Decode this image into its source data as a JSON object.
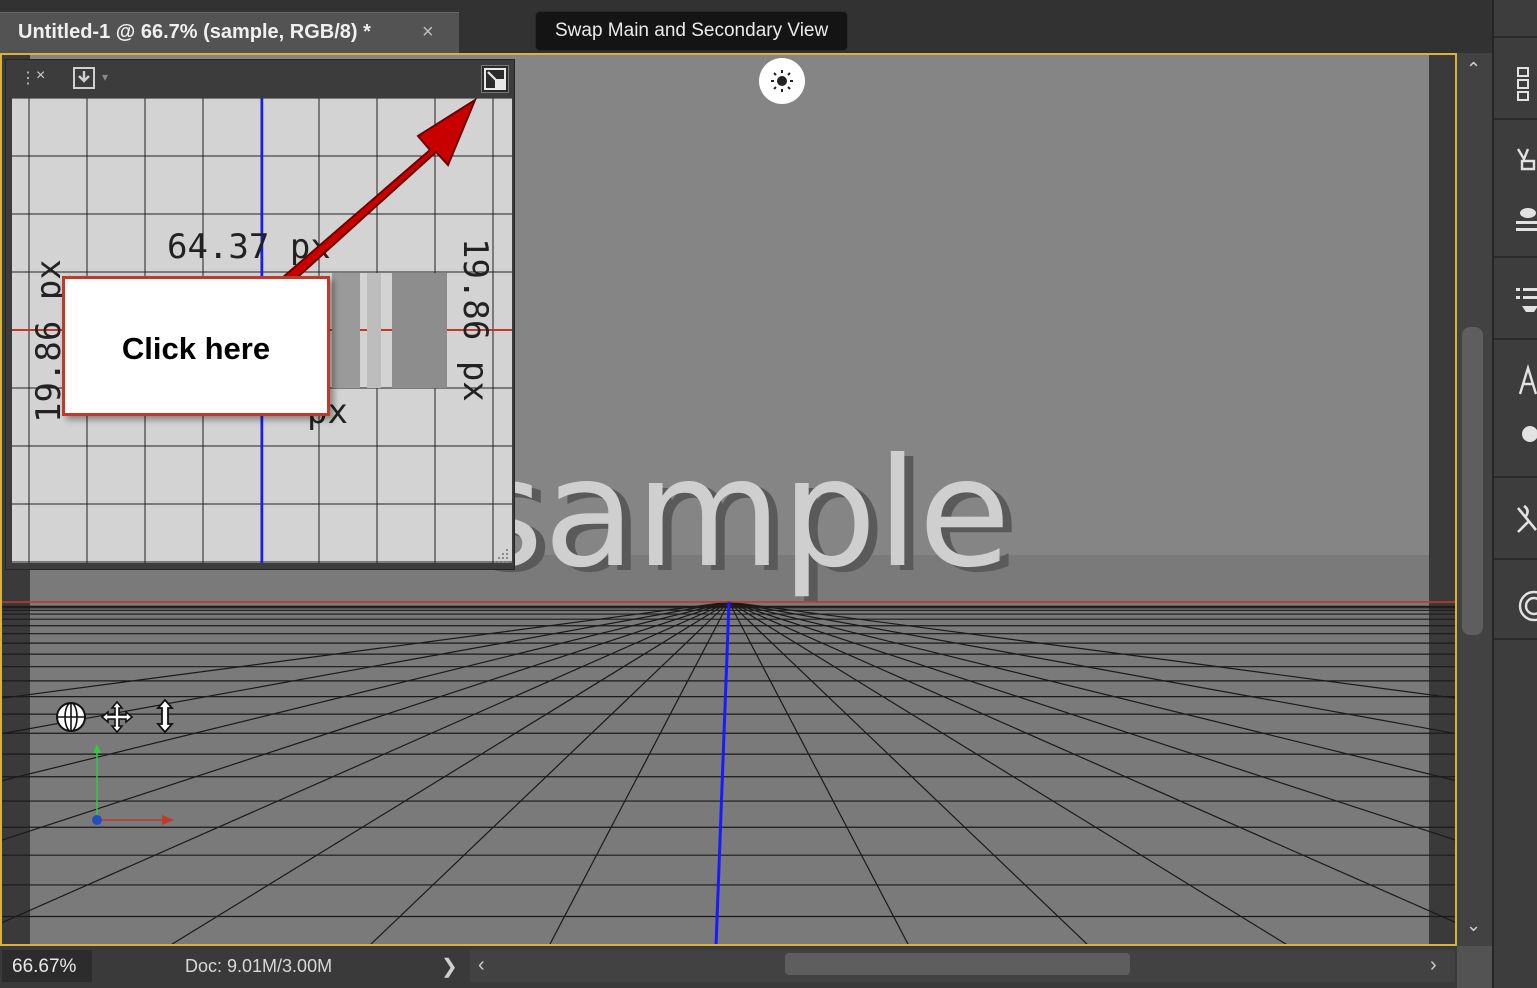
{
  "document_tab": {
    "title": "Untitled-1 @ 66.7% (sample, RGB/8) *",
    "close_glyph": "×"
  },
  "tooltip": {
    "text": "Swap Main and Secondary View"
  },
  "scene": {
    "text": "sample",
    "colors": {
      "background": "#7d7d7d",
      "grid_line": "#1a1a1a",
      "x_axis": "#c0392b",
      "y_axis": "#1a1aff",
      "frame": "#d6b33a"
    }
  },
  "secondary_view": {
    "close_glyph": "×",
    "measure_top": "64.37 px",
    "measure_left": "19.86 px",
    "measure_right": "19.86 px",
    "measure_bottom_partial": "px",
    "icons": [
      "grip-icon",
      "close-icon",
      "export-icon",
      "swap-view-icon"
    ]
  },
  "callout": {
    "text": "Click here",
    "border_color": "#c0392b"
  },
  "navigation_tools": [
    "orbit-icon",
    "pan-icon",
    "dolly-icon"
  ],
  "status": {
    "zoom": "66.67%",
    "doc_info": "Doc: 9.01M/3.00M",
    "expand_glyph": "❯"
  },
  "scroll": {
    "up_glyph": "⌃",
    "down_glyph": "⌄",
    "left_glyph": "‹",
    "right_glyph": "›"
  }
}
